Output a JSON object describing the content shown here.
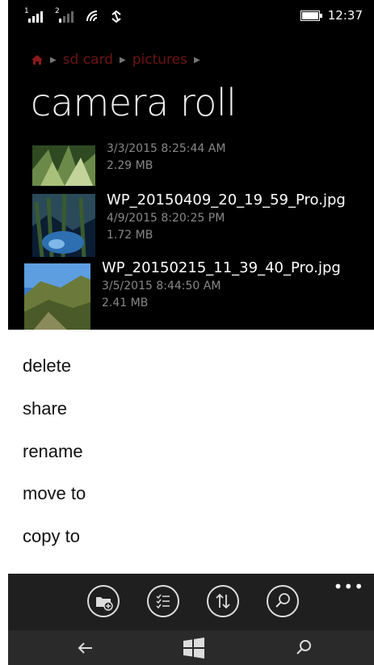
{
  "status": {
    "sim1": "1",
    "sim2": "2",
    "time": "12:37"
  },
  "breadcrumb": {
    "items": [
      "sd card",
      "pictures"
    ]
  },
  "page_title": "camera roll",
  "files": [
    {
      "name": "",
      "date": "3/3/2015 8:25:44 AM",
      "size": "2.29 MB"
    },
    {
      "name": "WP_20150409_20_19_59_Pro.jpg",
      "date": "4/9/2015 8:20:25 PM",
      "size": "1.72 MB"
    },
    {
      "name": "WP_20150215_11_39_40_Pro.jpg",
      "date": "3/5/2015 8:44:50 AM",
      "size": "2.41 MB"
    }
  ],
  "context_menu": {
    "items": [
      "delete",
      "share",
      "rename",
      "move to",
      "copy to"
    ]
  },
  "appbar": {
    "buttons": [
      "new-folder-icon",
      "select-icon",
      "sort-icon",
      "search-icon"
    ],
    "more": "•••"
  },
  "navbar": {
    "buttons": [
      "back-icon",
      "windows-start-icon",
      "search-icon"
    ]
  },
  "colors": {
    "background": "#000000",
    "breadcrumb": "#6b1414",
    "menu_background": "#ffffff",
    "appbar": "#1f1f1f"
  }
}
